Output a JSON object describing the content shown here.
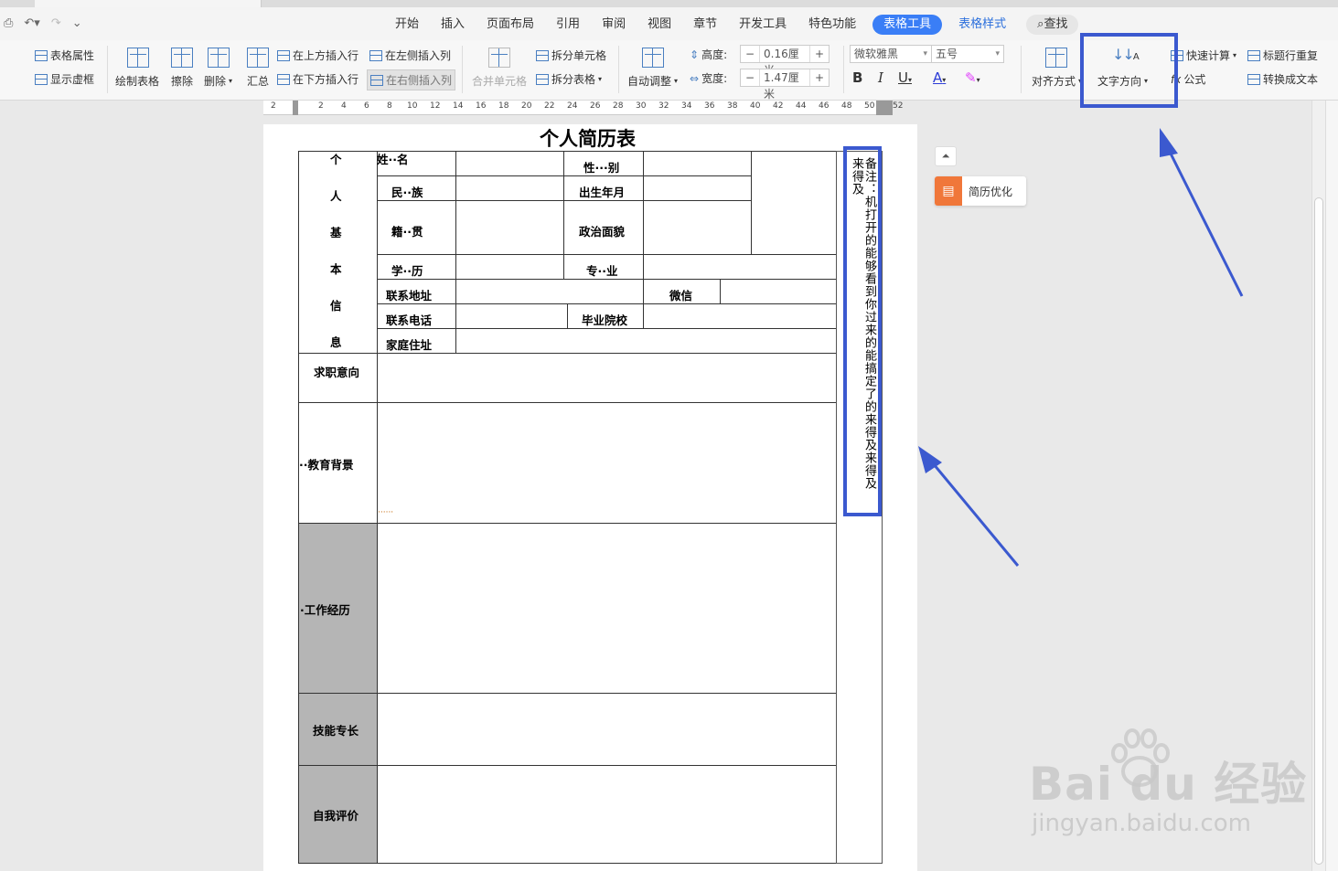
{
  "menu": {
    "tabs": [
      "开始",
      "插入",
      "页面布局",
      "引用",
      "审阅",
      "视图",
      "章节",
      "开发工具",
      "特色功能"
    ],
    "table_tools": "表格工具",
    "table_style": "表格样式",
    "search": "查找"
  },
  "ribbon": {
    "table_props": "表格属性",
    "show_gridlines": "显示虚框",
    "draw_table": "绘制表格",
    "erase": "擦除",
    "delete": "删除",
    "summary": "汇总",
    "insert_above": "在上方插入行",
    "insert_below": "在下方插入行",
    "insert_left": "在左侧插入列",
    "insert_right": "在右侧插入列",
    "merge_cells": "合并单元格",
    "split_cells": "拆分单元格",
    "split_table": "拆分表格",
    "auto_fit": "自动调整",
    "height_label": "高度:",
    "height_value": "0.16厘米",
    "width_label": "宽度:",
    "width_value": "1.47厘米",
    "font_name": "微软雅黑",
    "font_size": "五号",
    "align": "对齐方式",
    "text_direction": "文字方向",
    "quick_calc": "快速计算",
    "formula": "公式",
    "header_repeat": "标题行重复",
    "to_text": "转换成文本",
    "colors": {
      "font_a": "#2b3bd6",
      "highlight": "#e040fb",
      "accent": "#3a7ef6"
    }
  },
  "ruler": [
    "2",
    "2",
    "4",
    "6",
    "8",
    "10",
    "12",
    "14",
    "16",
    "18",
    "20",
    "22",
    "24",
    "26",
    "28",
    "30",
    "32",
    "34",
    "36",
    "38",
    "40",
    "42",
    "44",
    "46",
    "48",
    "50",
    "52"
  ],
  "doc": {
    "title": "个人简历表",
    "section_basic": [
      "个",
      "人",
      "基",
      "本",
      "信",
      "息"
    ],
    "labels": {
      "name": "姓··名",
      "gender": "性···别",
      "ethnicity": "民··族",
      "birth": "出生年月",
      "native": "籍··贯",
      "politics": "政治面貌",
      "education": "学··历",
      "major": "专··业",
      "address": "联系地址",
      "wechat": "微信",
      "phone": "联系电话",
      "school": "毕业院校",
      "home": "家庭住址",
      "job_intent": "求职意向",
      "edu_bg": "··教育背景",
      "work_exp": "·工作经历",
      "skills": "技能专长",
      "self_eval": "自我评价"
    },
    "dots": "······",
    "note": "备注：机打开的能够看到你过来的能搞定了的来得及来得及来得及"
  },
  "side_panel": {
    "collapse": "⏶",
    "resume_opt": "简历优化"
  },
  "watermark": {
    "brand": "Bai  du 经验",
    "url": "jingyan.baidu.com"
  }
}
